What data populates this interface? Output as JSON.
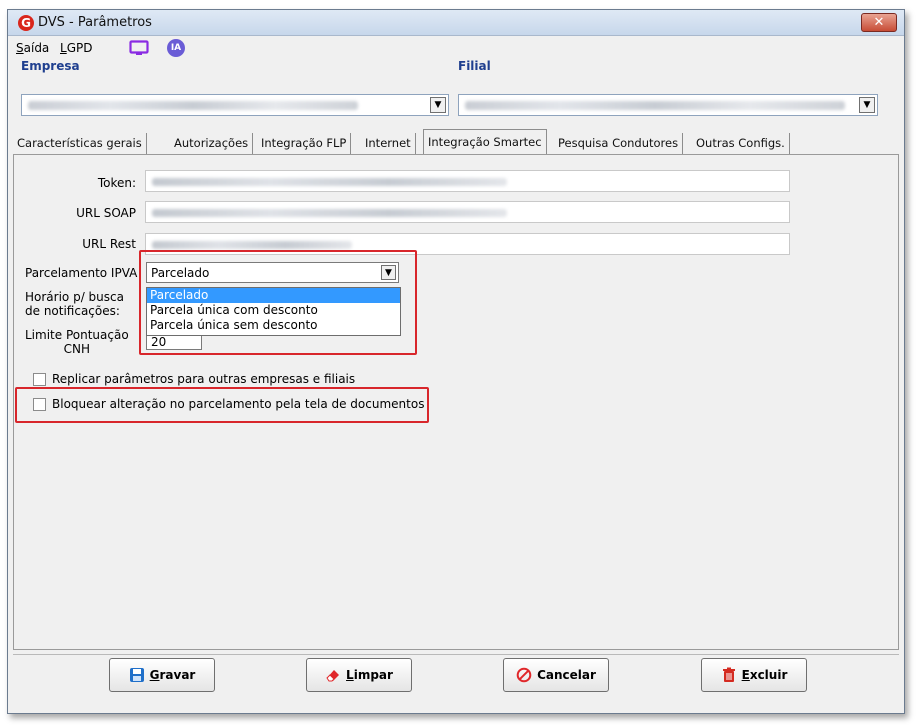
{
  "window": {
    "title": "DVS - Parâmetros",
    "logo_letter": "G",
    "close_symbol": "✕"
  },
  "menu": {
    "items": [
      {
        "label": "Saída",
        "accel": "S",
        "rest": "aída"
      },
      {
        "label": "LGPD",
        "accel": "L",
        "rest": "GPD"
      }
    ],
    "ia_label": "IA"
  },
  "company": {
    "empresa_label": "Empresa",
    "filial_label": "Filial"
  },
  "tabs": [
    {
      "label": "Características gerais"
    },
    {
      "label": "Autorizações"
    },
    {
      "label": "Integração FLP"
    },
    {
      "label": "Internet"
    },
    {
      "label": "Integração Smartec",
      "active": true
    },
    {
      "label": "Pesquisa Condutores"
    },
    {
      "label": "Outras Configs."
    }
  ],
  "form": {
    "token_label": "Token:",
    "url_soap_label": "URL SOAP",
    "url_rest_label": "URL Rest",
    "parcelamento_label": "Parcelamento IPVA",
    "parcelamento_value": "Parcelado",
    "parcelamento_options": [
      "Parcelado",
      "Parcela única com desconto",
      "Parcela única sem desconto"
    ],
    "horario_label_1": "Horário p/ busca",
    "horario_label_2": "de notificações:",
    "limite_label_1": "Limite Pontuação",
    "limite_label_2": "CNH",
    "limite_value": "20",
    "replicar_label": "Replicar parâmetros para outras empresas e filiais",
    "replicar_checked": false,
    "bloquear_label": "Bloquear alteração no parcelamento pela tela de documentos",
    "bloquear_checked": false
  },
  "buttons": {
    "gravar": {
      "accel": "G",
      "rest": "ravar",
      "icon": "save-icon"
    },
    "limpar": {
      "accel": "L",
      "rest": "impar",
      "icon": "eraser-icon"
    },
    "cancelar": {
      "label": "Cancelar",
      "icon": "cancel-icon"
    },
    "excluir": {
      "accel": "E",
      "rest": "xcluir",
      "icon": "trash-icon"
    }
  },
  "colors": {
    "highlight": "#d8262b",
    "selection": "#3399ff",
    "group_label": "#1f3f8f"
  }
}
